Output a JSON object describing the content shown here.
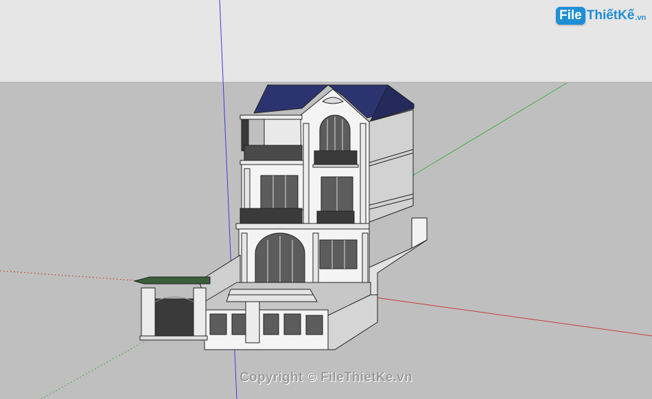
{
  "watermark": {
    "logo_file": "File",
    "logo_thietke": "ThiếtKế",
    "logo_vn": ".vn",
    "copyright": "Copyright © FileThietKe.vn"
  },
  "colors": {
    "sky": "#e6e6e6",
    "ground": "#bfbfbf",
    "roof": "#2c3470",
    "wall": "#f4f4f4",
    "shadow_wall": "#cfcfcf",
    "glass": "#5c5c5c",
    "axis_blue": "#3b3bdb",
    "axis_green": "#3bb34a",
    "axis_red": "#c83a3a",
    "logo_blue": "#1e8fd6"
  },
  "icons": {
    "logo": "filethietke-logo"
  }
}
